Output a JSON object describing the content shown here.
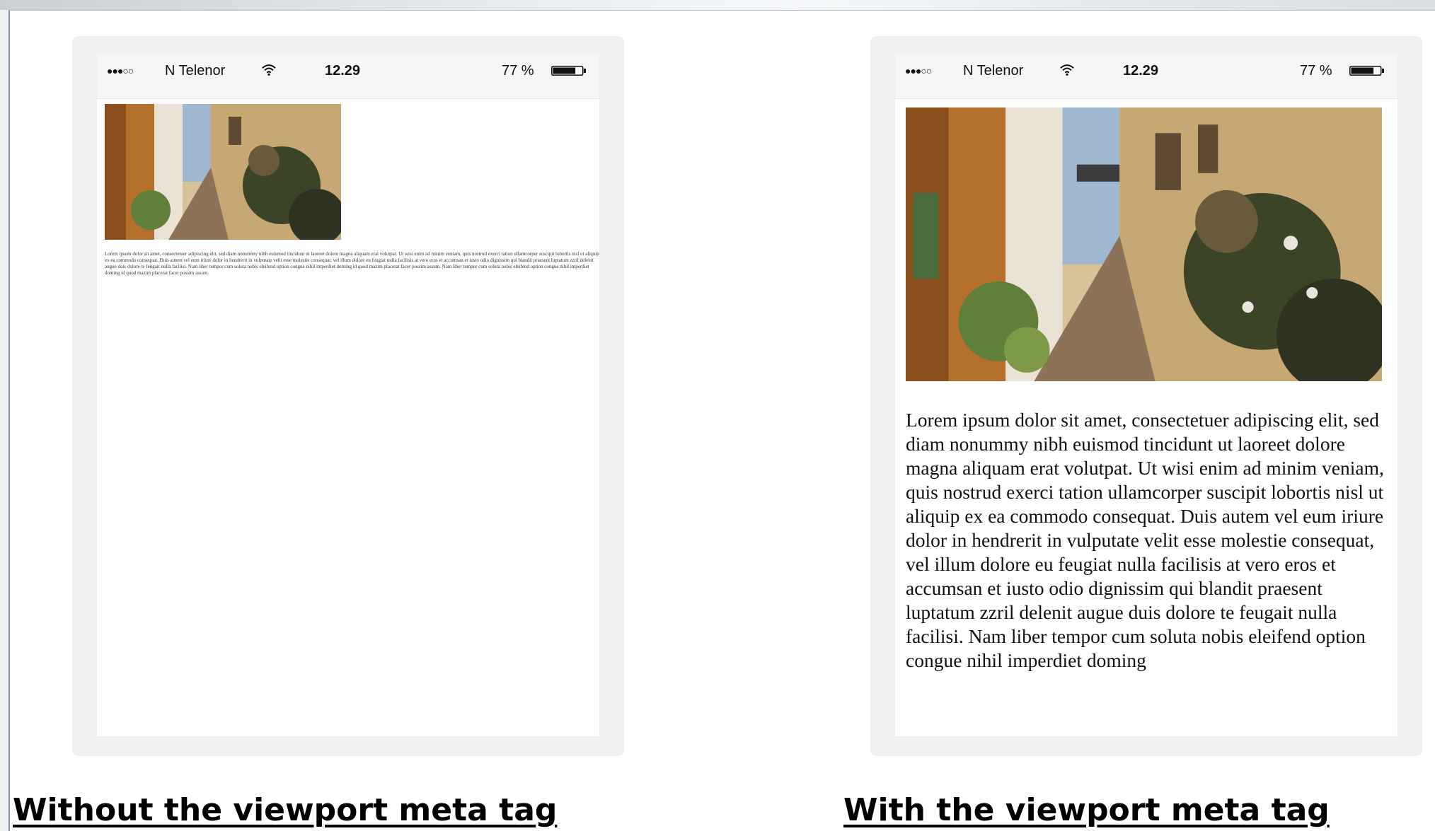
{
  "status_bar": {
    "signal_dots": "●●●○○",
    "carrier": "N Telenor",
    "wifi_icon": "wifi-icon",
    "time": "12.29",
    "battery_text": "77 %",
    "battery_icon": "battery-icon",
    "battery_level": 0.77
  },
  "left_example": {
    "photo_icon": "street-photo",
    "body_text": "Lorem ipsum dolor sit amet, consectetuer adipiscing elit, sed diam nonummy nibh euismod tincidunt ut laoreet dolore magna aliquam erat volutpat. Ut wisi enim ad minim veniam, quis nostrud exerci tation ullamcorper suscipit lobortis nisl ut aliquip ex ea commodo consequat. Duis autem vel eum iriure dolor in hendrerit in vulputate velit esse molestie consequat, vel illum dolore eu feugiat nulla facilisis at vero eros et accumsan et iusto odio dignissim qui blandit praesent luptatum zzril delenit augue duis dolore te feugait nulla facilisi. Nam liber tempor cum soluta nobis eleifend option congue nihil imperdiet doming id quod mazim placerat facer possim assum. Nam liber tempor cum soluta nobis eleifend option congue nihil imperdiet doming id quod mazim placerat facer possim assum.",
    "caption": "Without the viewport meta tag"
  },
  "right_example": {
    "photo_icon": "street-photo",
    "body_text": "Lorem ipsum dolor sit amet, consectetuer adipiscing elit, sed diam nonummy nibh euismod tincidunt ut laoreet dolore magna aliquam erat volutpat. Ut wisi enim ad minim veniam, quis nostrud exerci tation ullamcorper suscipit lobortis nisl ut aliquip ex ea commodo consequat. Duis autem vel eum iriure dolor in hendrerit in vulputate velit esse molestie consequat, vel illum dolore eu feugiat nulla facilisis at vero eros et accumsan et iusto odio dignissim qui blandit praesent luptatum zzril delenit augue duis dolore te feugait nulla facilisi. Nam liber tempor cum soluta nobis eleifend option congue nihil imperdiet doming",
    "caption": "With the viewport meta tag"
  }
}
